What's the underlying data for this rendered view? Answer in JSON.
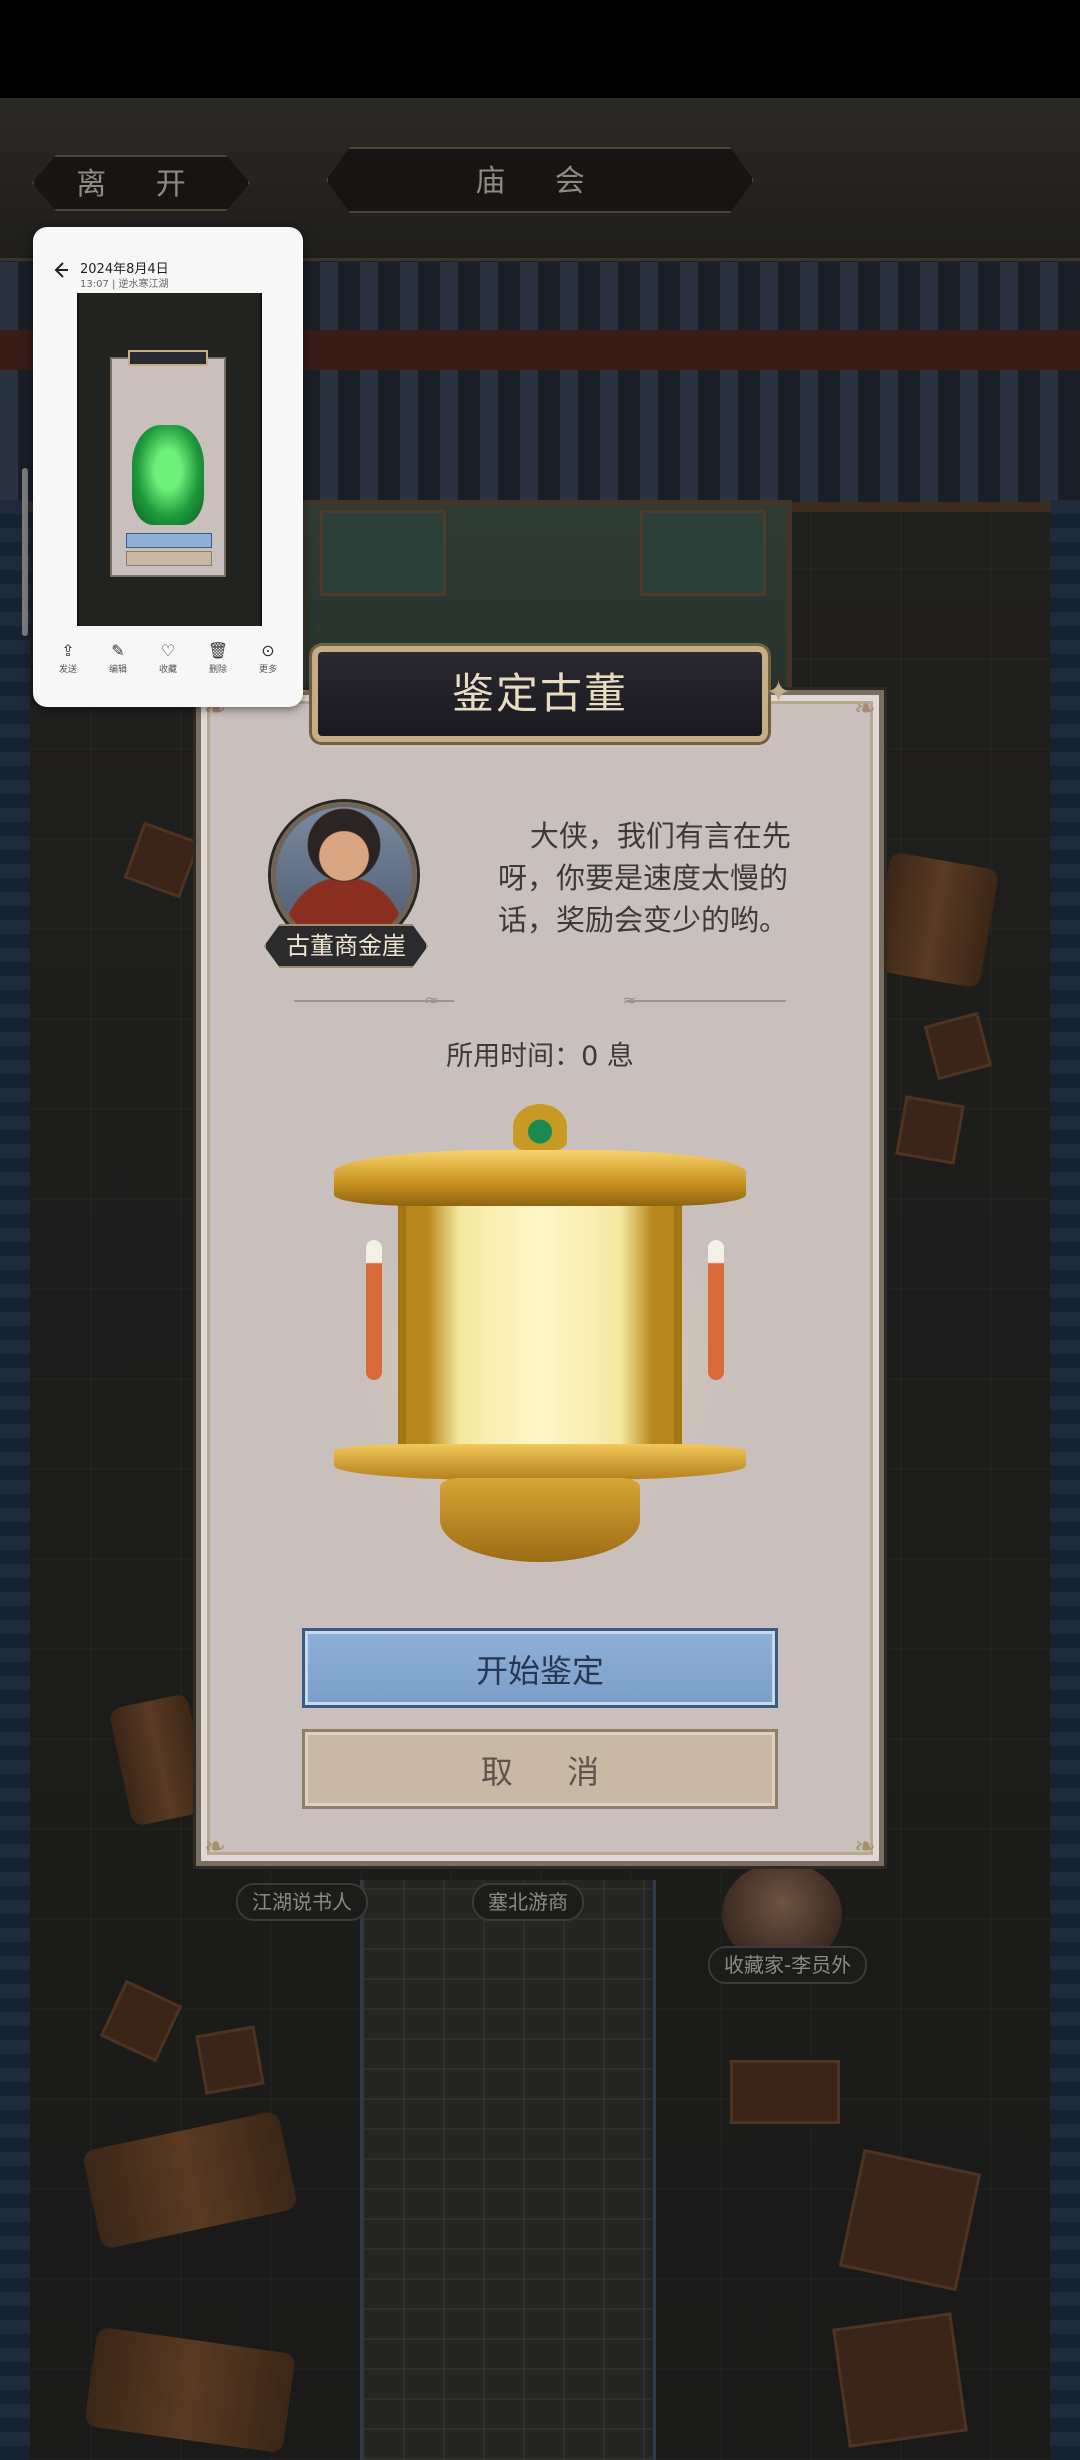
{
  "top_bar": {
    "leave_label": "离 开",
    "location_label": "庙 会"
  },
  "npcs": [
    {
      "label": "江湖说书人"
    },
    {
      "label": "塞北游商"
    },
    {
      "label": "收藏家-李员外"
    }
  ],
  "dialog": {
    "title": "鉴定古董",
    "merchant_name": "古董商金崖",
    "speech": "大侠，我们有言在先呀，你要是速度太慢的话，奖励会变少的哟。",
    "time_label": "所用时间：0 息",
    "item": "golden-lantern",
    "start_label": "开始鉴定",
    "cancel_label": "取 消"
  },
  "screenshot_preview": {
    "date": "2024年8月4日",
    "subtitle": "13:07 | 逆水寒江湖",
    "actions": [
      {
        "label": "发送",
        "icon": "share-icon"
      },
      {
        "label": "编辑",
        "icon": "edit-icon"
      },
      {
        "label": "收藏",
        "icon": "heart-icon"
      },
      {
        "label": "删除",
        "icon": "trash-icon"
      },
      {
        "label": "更多",
        "icon": "more-icon"
      }
    ]
  },
  "colors": {
    "primary_button": "#8fb1d8",
    "secondary_button": "#c7b9a5",
    "dialog_bg": "#c9c0be",
    "title_text": "#e9dcc0"
  }
}
